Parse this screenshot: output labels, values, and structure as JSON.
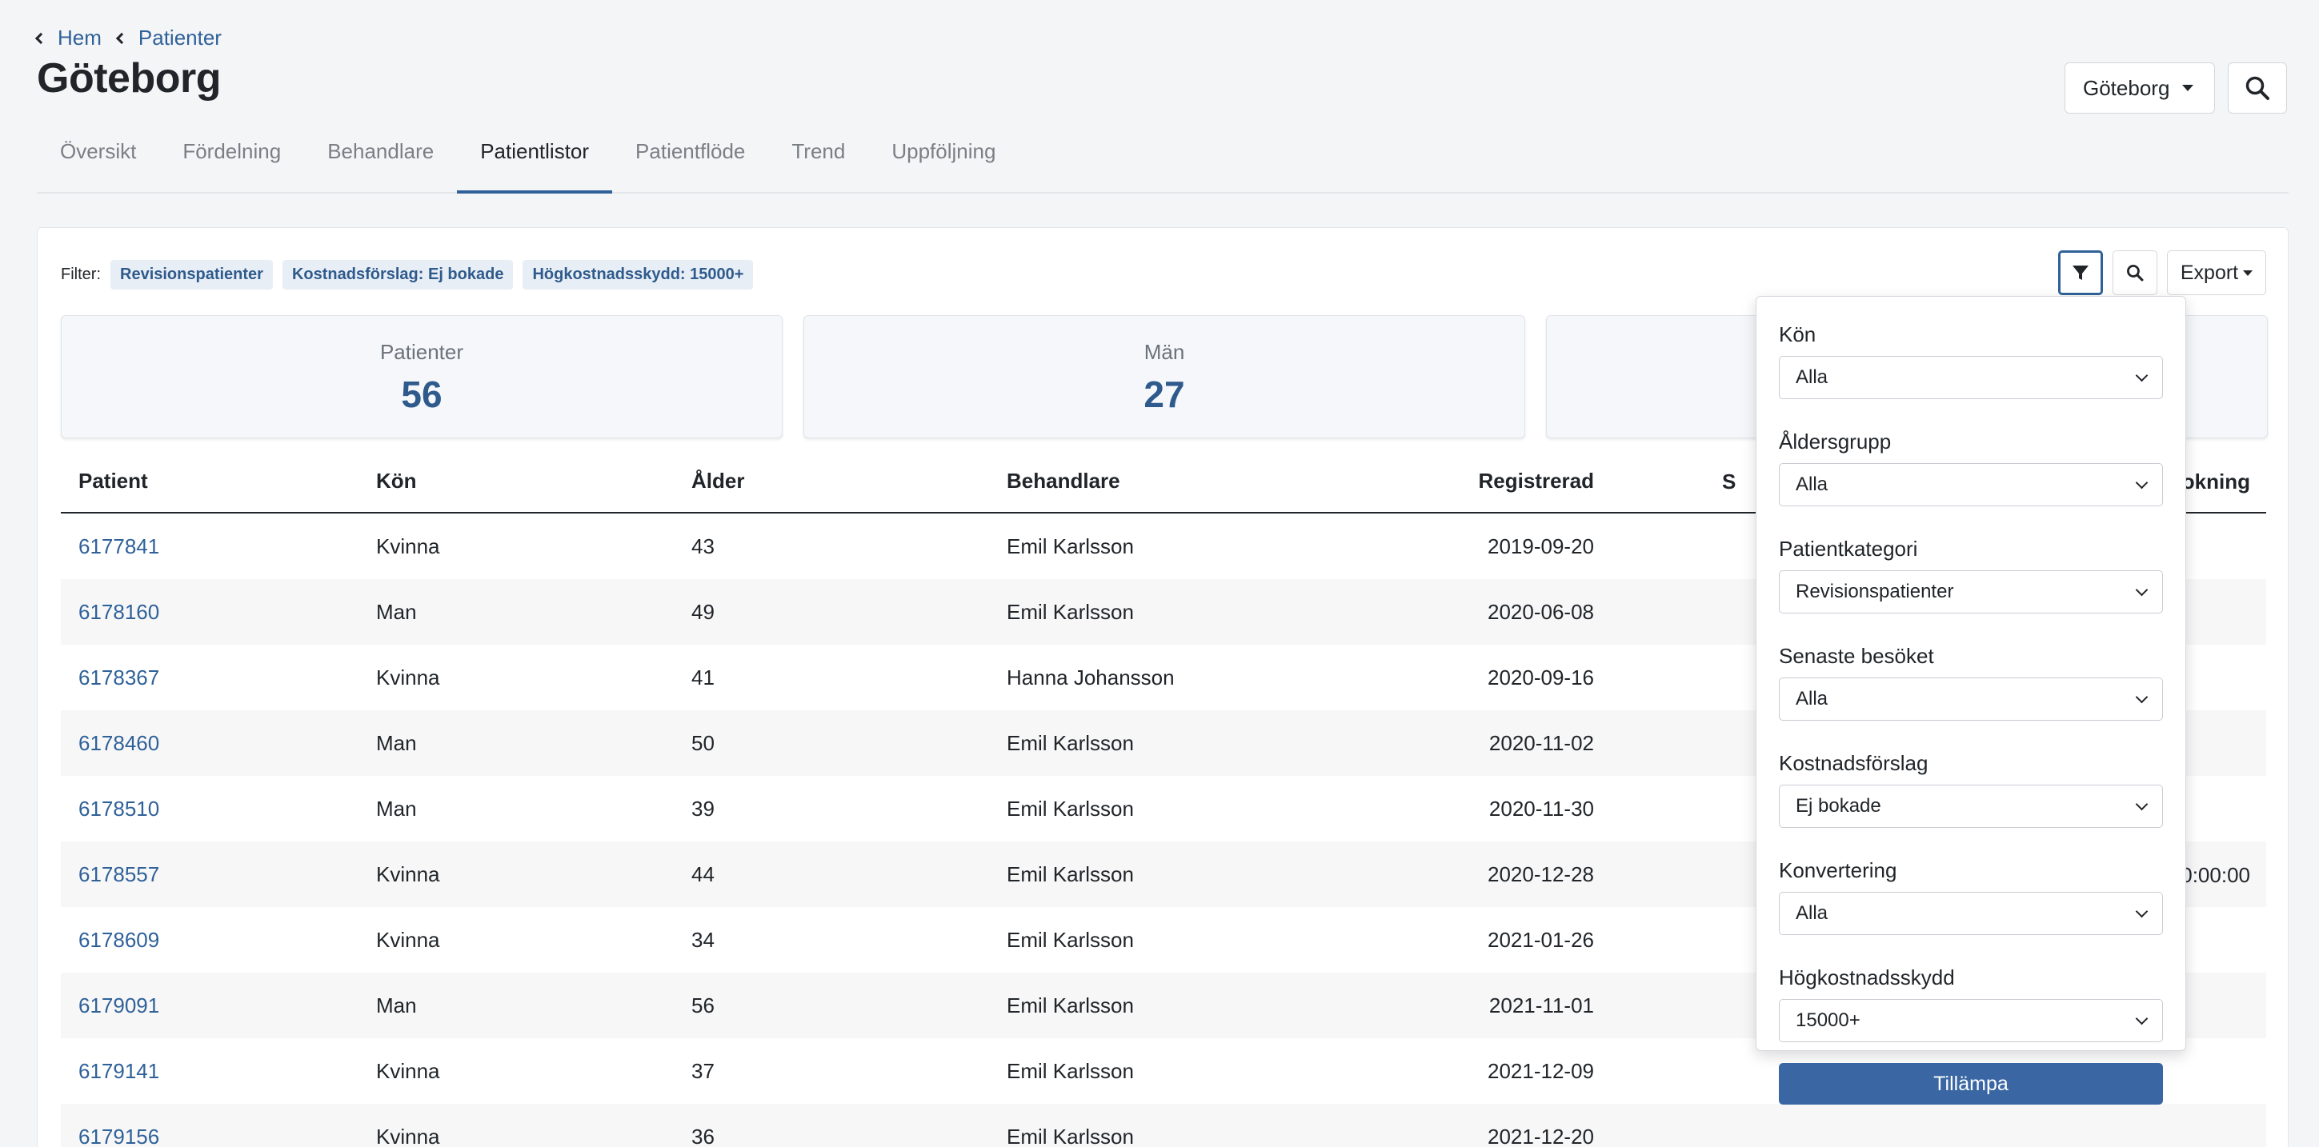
{
  "breadcrumb": [
    "Hem",
    "Patienter"
  ],
  "page_title": "Göteborg",
  "city_select": "Göteborg",
  "tabs": [
    {
      "label": "Översikt"
    },
    {
      "label": "Fördelning"
    },
    {
      "label": "Behandlare"
    },
    {
      "label": "Patientlistor"
    },
    {
      "label": "Patientflöde"
    },
    {
      "label": "Trend"
    },
    {
      "label": "Uppföljning"
    }
  ],
  "active_tab": "Patientlistor",
  "filter": {
    "label": "Filter:",
    "chips": [
      "Revisionspatienter",
      "Kostnadsförslag: Ej bokade",
      "Högkostnadsskydd: 15000+"
    ]
  },
  "toolbar": {
    "export_label": "Export"
  },
  "stats": [
    {
      "label": "Patienter",
      "value": "56"
    },
    {
      "label": "Män",
      "value": "27"
    }
  ],
  "table": {
    "headers": {
      "patient": "Patient",
      "kon": "Kön",
      "alder": "Ålder",
      "behandlare": "Behandlare",
      "registrerad": "Registrerad",
      "partial_s": "S",
      "partial_bokning": "okning"
    },
    "rows": [
      {
        "patient": "6177841",
        "kon": "Kvinna",
        "alder": "43",
        "behandlare": "Emil Karlsson",
        "registrerad": "2019-09-20",
        "extra": ""
      },
      {
        "patient": "6178160",
        "kon": "Man",
        "alder": "49",
        "behandlare": "Emil Karlsson",
        "registrerad": "2020-06-08",
        "extra": ""
      },
      {
        "patient": "6178367",
        "kon": "Kvinna",
        "alder": "41",
        "behandlare": "Hanna Johansson",
        "registrerad": "2020-09-16",
        "extra": ""
      },
      {
        "patient": "6178460",
        "kon": "Man",
        "alder": "50",
        "behandlare": "Emil Karlsson",
        "registrerad": "2020-11-02",
        "extra": ""
      },
      {
        "patient": "6178510",
        "kon": "Man",
        "alder": "39",
        "behandlare": "Emil Karlsson",
        "registrerad": "2020-11-30",
        "extra": ""
      },
      {
        "patient": "6178557",
        "kon": "Kvinna",
        "alder": "44",
        "behandlare": "Emil Karlsson",
        "registrerad": "2020-12-28",
        "extra": "0:00:00"
      },
      {
        "patient": "6178609",
        "kon": "Kvinna",
        "alder": "34",
        "behandlare": "Emil Karlsson",
        "registrerad": "2021-01-26",
        "extra": ""
      },
      {
        "patient": "6179091",
        "kon": "Man",
        "alder": "56",
        "behandlare": "Emil Karlsson",
        "registrerad": "2021-11-01",
        "extra": ""
      },
      {
        "patient": "6179141",
        "kon": "Kvinna",
        "alder": "37",
        "behandlare": "Emil Karlsson",
        "registrerad": "2021-12-09",
        "extra": ""
      },
      {
        "patient": "6179156",
        "kon": "Kvinna",
        "alder": "36",
        "behandlare": "Emil Karlsson",
        "registrerad": "2021-12-20",
        "extra": ""
      }
    ]
  },
  "filter_panel": {
    "fields": [
      {
        "label": "Kön",
        "value": "Alla"
      },
      {
        "label": "Åldersgrupp",
        "value": "Alla"
      },
      {
        "label": "Patientkategori",
        "value": "Revisionspatienter"
      },
      {
        "label": "Senaste besöket",
        "value": "Alla"
      },
      {
        "label": "Kostnadsförslag",
        "value": "Ej bokade"
      },
      {
        "label": "Konvertering",
        "value": "Alla"
      },
      {
        "label": "Högkostnadsskydd",
        "value": "15000+"
      }
    ],
    "apply_label": "Tillämpa"
  },
  "colors": {
    "accent": "#2f6199",
    "apply_button": "#3a67a4",
    "stat_value": "#2f5a8c",
    "chip_bg": "#e8eef6"
  }
}
